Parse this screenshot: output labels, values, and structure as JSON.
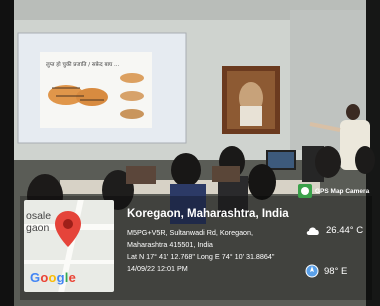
{
  "photo": {
    "slide_heading": "लुप्त हो चुकी प्रजाति / सफ़ेद बाघ ...",
    "scene_description_icons": [
      "presentation-screen",
      "framed-portrait",
      "speaker",
      "audience"
    ]
  },
  "map_thumbnail": {
    "place_label_line1": "osale",
    "place_label_line2": "gaon",
    "logo": "Google"
  },
  "gps_badge": {
    "label": "GPS Map Camera"
  },
  "location": {
    "title": "Koregaon, Maharashtra, India",
    "address_line1": "M5PG+V5R, Sultanwadi Rd, Koregaon,",
    "address_line2": "Maharashtra 415501, India",
    "coords": "Lat N 17° 41' 12.768\" Long E 74° 10' 31.8864\"",
    "datetime": "14/09/22 12:01 PM"
  },
  "weather": {
    "temperature": "26.44° C",
    "wind": "98° E"
  }
}
